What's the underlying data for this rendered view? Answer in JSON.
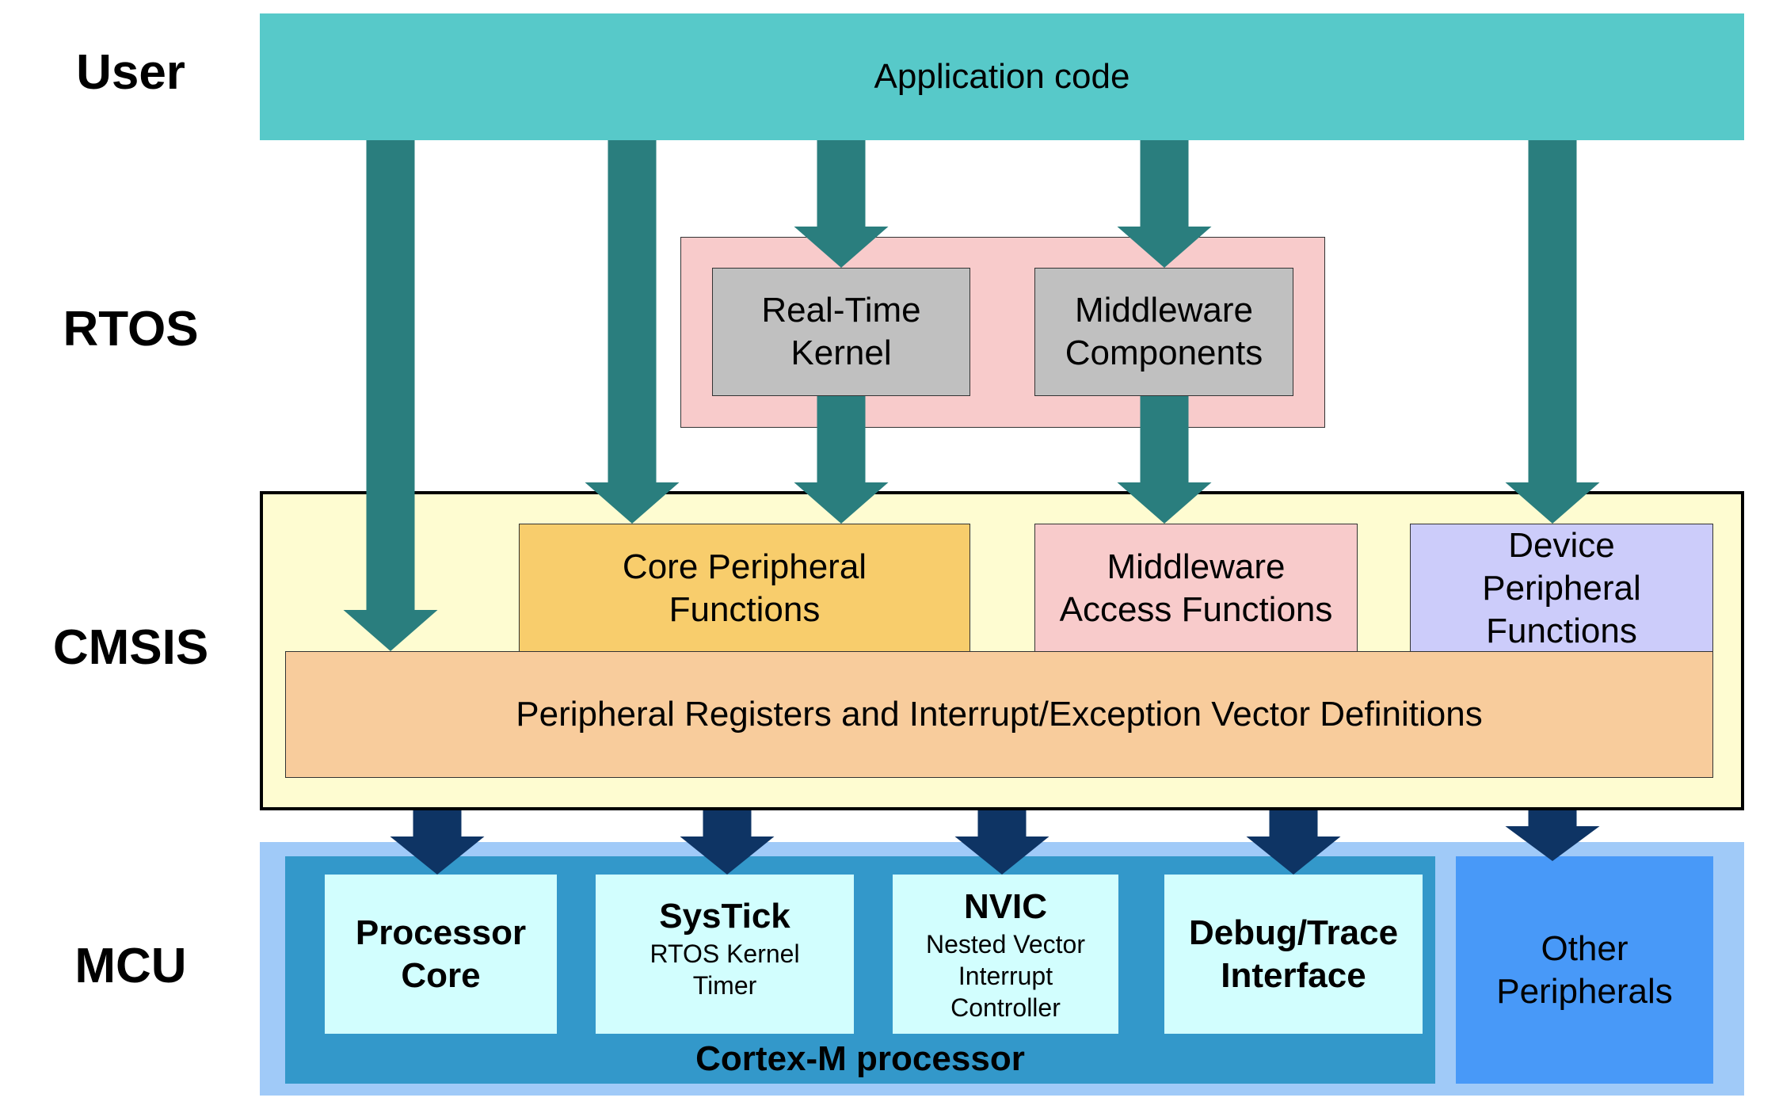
{
  "layers": {
    "user": "User",
    "rtos": "RTOS",
    "cmsis": "CMSIS",
    "mcu": "MCU"
  },
  "user": {
    "application_code": "Application code"
  },
  "rtos": {
    "real_time_kernel": [
      "Real-Time",
      "Kernel"
    ],
    "middleware_components": [
      "Middleware",
      "Components"
    ]
  },
  "cmsis": {
    "core_peripheral_functions": [
      "Core Peripheral",
      "Functions"
    ],
    "middleware_access_functions": [
      "Middleware",
      "Access Functions"
    ],
    "device_peripheral_functions": [
      "Device",
      "Peripheral",
      "Functions"
    ],
    "peripheral_registers": "Peripheral Registers and Interrupt/Exception Vector Definitions"
  },
  "mcu": {
    "processor_core": [
      "Processor",
      "Core"
    ],
    "systick": {
      "title": "SysTick",
      "sub": [
        "RTOS Kernel",
        "Timer"
      ]
    },
    "nvic": {
      "title": "NVIC",
      "sub": [
        "Nested Vector",
        "Interrupt",
        "Controller"
      ]
    },
    "debug_trace": [
      "Debug/Trace",
      "Interface"
    ],
    "cortex_m_label": "Cortex-M processor",
    "other_peripherals": [
      "Other",
      "Peripherals"
    ]
  },
  "colors": {
    "application": "#57C9C9",
    "teal_arrow": "#2A7E7E",
    "rtos_bg": "#F8CBCB",
    "rtos_box": "#C0C0C0",
    "cmsis_bg": "#FEFCD1",
    "core_periph": "#F8CD6C",
    "mw_access": "#F8CBCB",
    "device_periph": "#CCCCFA",
    "periph_regs": "#F8CC9C",
    "mcu_outer": "#A0CAF8",
    "cortex": "#3398CA",
    "mcu_box": "#D2FEFE",
    "other_periph": "#4899F8",
    "navy_arrow": "#0E3464"
  }
}
